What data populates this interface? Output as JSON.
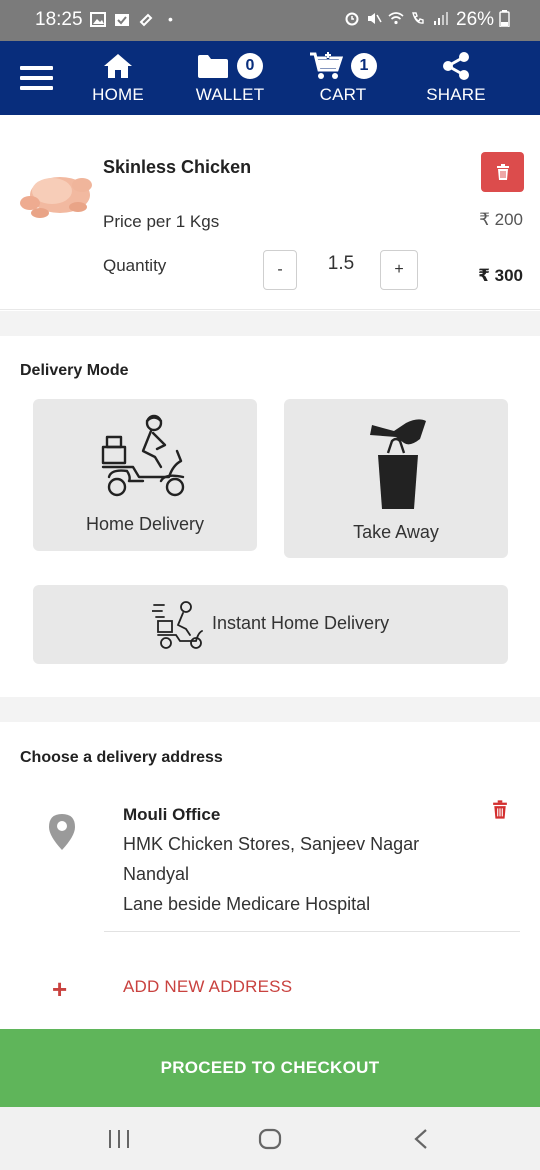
{
  "status_bar": {
    "time": "18:25",
    "dot": "•",
    "battery": "26%",
    "left_icons": [
      "image-icon",
      "calendar-check-icon",
      "ticket-icon"
    ],
    "right_icons": [
      "alarm-icon",
      "mute-icon",
      "wifi-icon",
      "wifi-call-icon",
      "signal-icon",
      "battery-icon"
    ]
  },
  "navbar": {
    "menu_icon": "hamburger-menu-icon",
    "home": {
      "label": "HOME",
      "icon": "home-icon"
    },
    "wallet": {
      "label": "WALLET",
      "icon": "folder-icon",
      "badge": "0"
    },
    "cart": {
      "label": "CART",
      "icon": "cart-add-icon",
      "badge": "1"
    },
    "share": {
      "label": "SHARE",
      "icon": "share-icon"
    },
    "bg_color": "#082d7c"
  },
  "product": {
    "name": "Skinless Chicken",
    "price_label": "Price per 1 Kgs",
    "unit_price": "₹ 200",
    "quantity_label": "Quantity",
    "decrement": "-",
    "quantity": "1.5",
    "increment": "+",
    "total": "₹ 300",
    "delete_icon": "trash-icon",
    "delete_color": "#dc4c4c"
  },
  "delivery_mode": {
    "title": "Delivery Mode",
    "options": [
      {
        "label": "Home Delivery",
        "icon": "scooter-rider-icon"
      },
      {
        "label": "Take Away",
        "icon": "shopping-bag-hand-icon"
      },
      {
        "label": "Instant Home Delivery",
        "icon": "fast-scooter-icon"
      }
    ]
  },
  "address": {
    "title": "Choose a delivery address",
    "name": "Mouli Office",
    "lines": [
      "HMK Chicken Stores, Sanjeev Nagar",
      "Nandyal",
      "Lane beside Medicare Hospital"
    ],
    "pin_icon": "location-pin-icon",
    "delete_icon": "trash-icon",
    "add_new": "ADD NEW ADDRESS",
    "add_icon": "plus-icon",
    "accent_color": "#c9423f"
  },
  "checkout": {
    "label": "PROCEED TO CHECKOUT",
    "color": "#5fb55a"
  },
  "system_nav": {
    "recent": "recent-apps-icon",
    "home": "home-circle-icon",
    "back": "back-icon"
  }
}
